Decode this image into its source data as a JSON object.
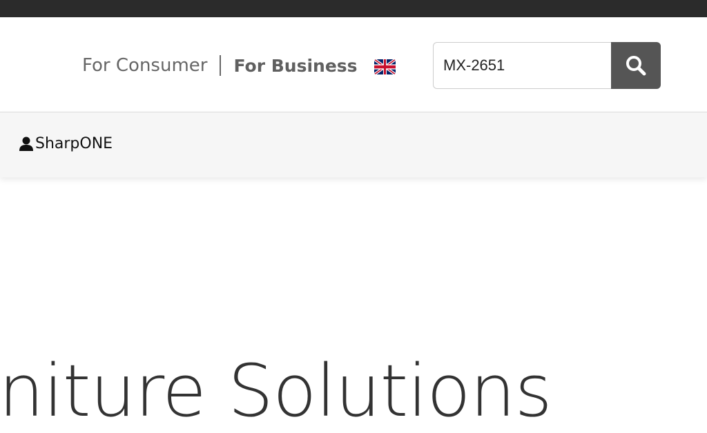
{
  "nav": {
    "consumer_label": "For Consumer",
    "business_label": "For Business"
  },
  "language": {
    "flag_icon": "uk-flag-icon"
  },
  "search": {
    "value": "MX-2651",
    "button_icon": "search-icon"
  },
  "subnav": {
    "account_label": "SharpONE",
    "account_icon": "user-icon"
  },
  "hero": {
    "title_fragment": "niture Solutions"
  },
  "colors": {
    "top_strip": "#2b2b2b",
    "search_button": "#555555",
    "subnav_bg": "#f6f6f6"
  }
}
